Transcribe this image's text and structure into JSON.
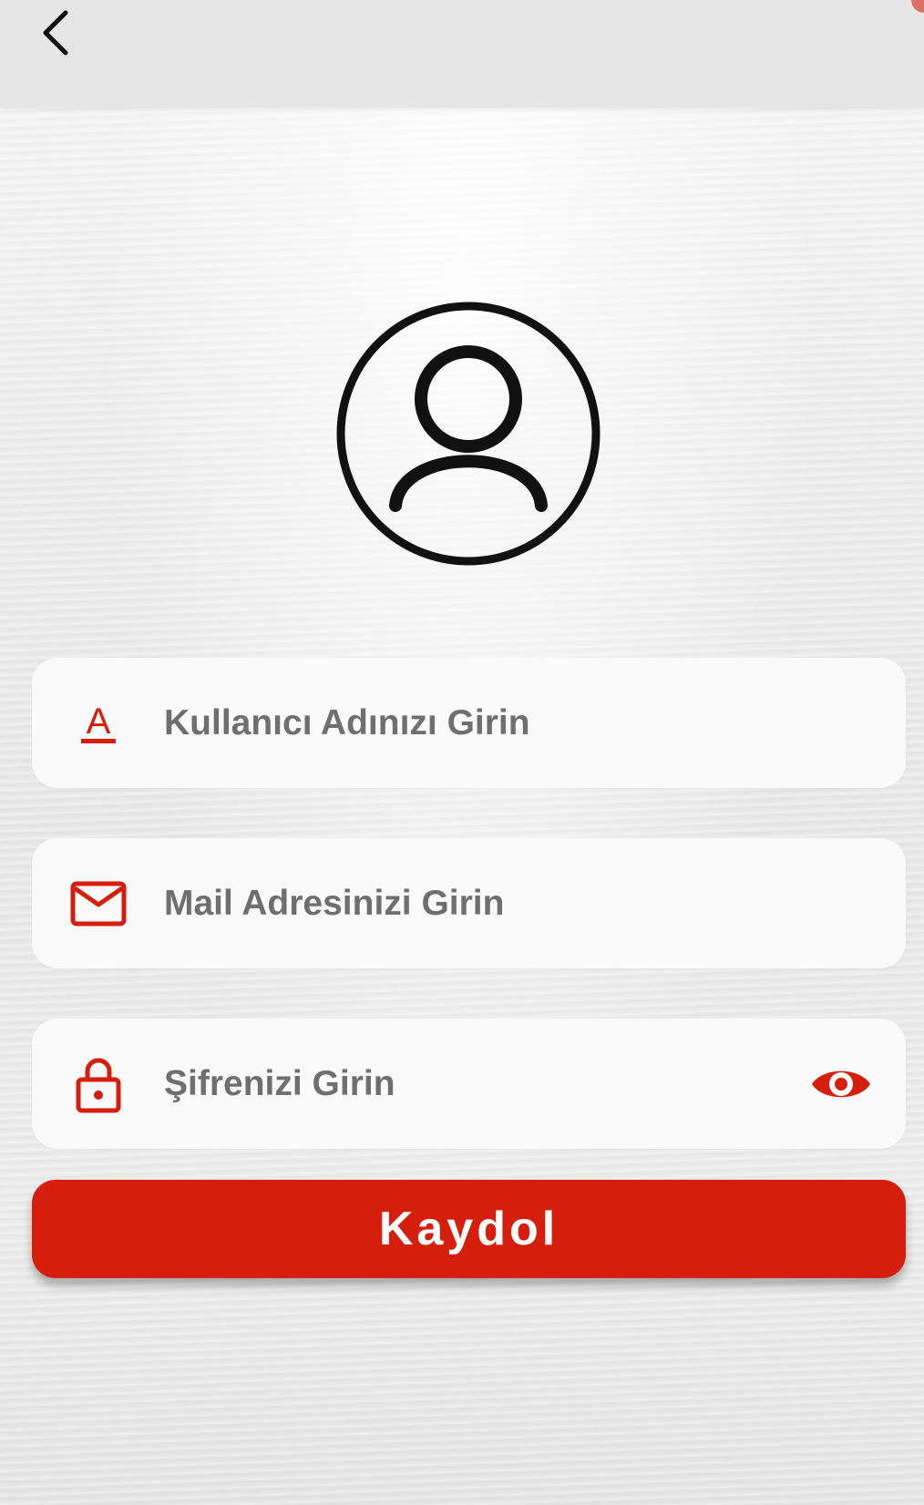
{
  "header": {
    "back_icon": "chevron-left-icon"
  },
  "avatar": {
    "icon": "user-circle-icon"
  },
  "form": {
    "username": {
      "icon": "letter-a-icon",
      "icon_text": "A",
      "placeholder": "Kullanıcı Adınızı Girin"
    },
    "email": {
      "icon": "mail-icon",
      "placeholder": "Mail Adresinizi Girin"
    },
    "password": {
      "icon": "lock-icon",
      "placeholder": "Şifrenizi Girin",
      "toggle_icon": "eye-icon"
    },
    "submit_label": "Kaydol"
  },
  "colors": {
    "accent": "#d61e0c",
    "placeholder": "#6f6f6f",
    "field_bg": "#fafafa",
    "app_bar": "#e6e6e6"
  }
}
